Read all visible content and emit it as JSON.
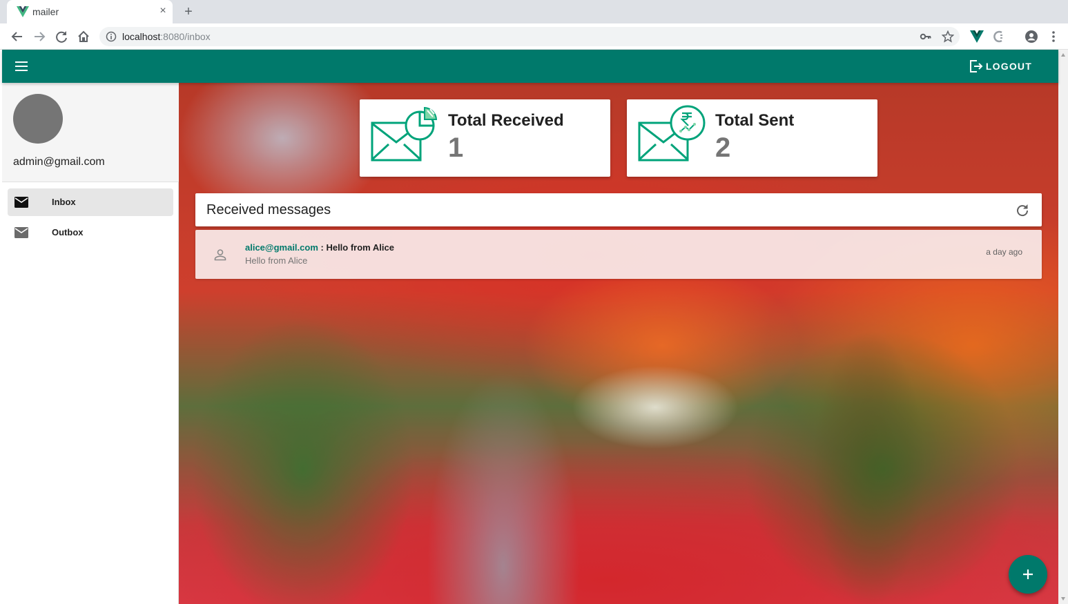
{
  "browser": {
    "tab_title": "mailer",
    "tab_close": "×",
    "new_tab": "+",
    "url_host": "localhost",
    "url_rest": ":8080/inbox",
    "icons": [
      "back-icon",
      "forward-icon",
      "reload-icon",
      "home-icon",
      "info-icon",
      "key-icon",
      "star-icon",
      "vue-devtools-icon",
      "extension-icon",
      "account-icon",
      "more-icon"
    ]
  },
  "appbar": {
    "color": "#00796b",
    "logout_label": "LOGOUT"
  },
  "sidebar": {
    "email": "admin@gmail.com",
    "items": [
      {
        "label": "Inbox",
        "icon": "mail-icon",
        "active": true
      },
      {
        "label": "Outbox",
        "icon": "mail-icon",
        "active": false
      }
    ]
  },
  "stats": [
    {
      "title": "Total Received",
      "value": "1",
      "icon": "received-stats-icon"
    },
    {
      "title": "Total Sent",
      "value": "2",
      "icon": "sent-stats-icon"
    }
  ],
  "messages": {
    "header": "Received messages",
    "items": [
      {
        "sender": "alice@gmail.com",
        "separator": " : ",
        "subject": "Hello from Alice",
        "preview": "Hello from Alice",
        "time": "a day ago"
      }
    ]
  },
  "fab": {
    "icon": "plus-icon"
  }
}
